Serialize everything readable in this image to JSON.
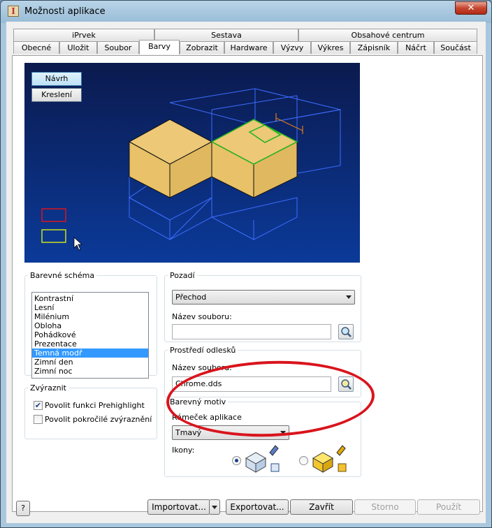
{
  "window": {
    "title": "Možnosti aplikace",
    "close_glyph": "✕"
  },
  "tabs_row1": [
    "iPrvek",
    "Sestava",
    "Obsahové centrum"
  ],
  "tabs_row2": [
    "Obecné",
    "Uložit",
    "Soubor",
    "Barvy",
    "Zobrazit",
    "Hardware",
    "Výzvy",
    "Výkres",
    "Zápisník",
    "Náčrt",
    "Součást"
  ],
  "active_tab": "Barvy",
  "preview": {
    "btn_design": "Návrh",
    "btn_drawing": "Kreslení"
  },
  "color_scheme": {
    "label": "Barevné schéma",
    "items": [
      "Kontrastní",
      "Lesní",
      "Milénium",
      "Obloha",
      "Pohádkové",
      "Prezentace",
      "Temná modř",
      "Zimní den",
      "Zimní noc"
    ],
    "selected": "Temná modř"
  },
  "highlight": {
    "label": "Zvýraznit",
    "prehighlight": {
      "label": "Povolit funkci Prehighlight",
      "checked": true
    },
    "enhanced": {
      "label": "Povolit pokročilé zvýraznění",
      "checked": false
    }
  },
  "background": {
    "label": "Pozadí",
    "value": "Přechod",
    "filename_label": "Název souboru:",
    "filename_value": ""
  },
  "reflection": {
    "label": "Prostředí odlesků",
    "filename_label": "Název souboru:",
    "filename_value": "Chrome.dds"
  },
  "color_theme": {
    "label": "Barevný motiv",
    "frame_label": "Rámeček aplikace",
    "frame_value": "Tmavý",
    "icons_label": "Ikony:",
    "selected_icon": 0
  },
  "buttons": {
    "help": "?",
    "import": "Importovat...",
    "export": "Exportovat...",
    "close": "Zavřít",
    "cancel": "Storno",
    "apply": "Použít"
  },
  "colors": {
    "accent_select": "#3399ff",
    "annotation": "#d9141c",
    "cube_face": "#e8c168"
  }
}
